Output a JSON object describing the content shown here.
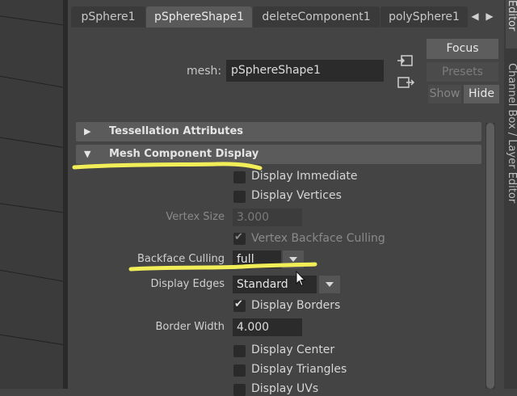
{
  "tabs": [
    {
      "label": "pSphere1",
      "active": false
    },
    {
      "label": "pSphereShape1",
      "active": true
    },
    {
      "label": "deleteComponent1",
      "active": false
    },
    {
      "label": "polySphere1",
      "active": false
    }
  ],
  "tab_scroll": {
    "left_icon": "chevron-left-icon",
    "right_icon": "chevron-right-icon"
  },
  "side_strip": {
    "tab1": "Editor",
    "tab2": "Channel Box / Layer Editor"
  },
  "mesh": {
    "label": "mesh:",
    "value": "pSphereShape1"
  },
  "buttons": {
    "focus": "Focus",
    "presets": "Presets",
    "show": "Show",
    "hide": "Hide"
  },
  "frames": {
    "tessellation": {
      "label": "Tessellation Attributes",
      "expanded": false
    },
    "mesh_display": {
      "label": "Mesh Component Display",
      "expanded": true
    }
  },
  "attributes": {
    "display_immediate": {
      "label": "Display Immediate",
      "checked": false
    },
    "display_vertices": {
      "label": "Display Vertices",
      "checked": false
    },
    "vertex_size": {
      "label": "Vertex Size",
      "value": "3.000",
      "enabled": false
    },
    "vertex_backface_culling": {
      "label": "Vertex Backface Culling",
      "checked": true,
      "enabled": false
    },
    "backface_culling": {
      "label": "Backface Culling",
      "value": "full"
    },
    "display_edges": {
      "label": "Display Edges",
      "value": "Standard"
    },
    "display_borders": {
      "label": "Display Borders",
      "checked": true
    },
    "border_width": {
      "label": "Border Width",
      "value": "4.000"
    },
    "display_center": {
      "label": "Display Center",
      "checked": false
    },
    "display_triangles": {
      "label": "Display Triangles",
      "checked": false
    },
    "display_uvs": {
      "label": "Display UVs",
      "checked": false
    }
  },
  "colors": {
    "highlight": "#f2ee58",
    "panel": "#444444",
    "frame": "#5b5b5b"
  }
}
